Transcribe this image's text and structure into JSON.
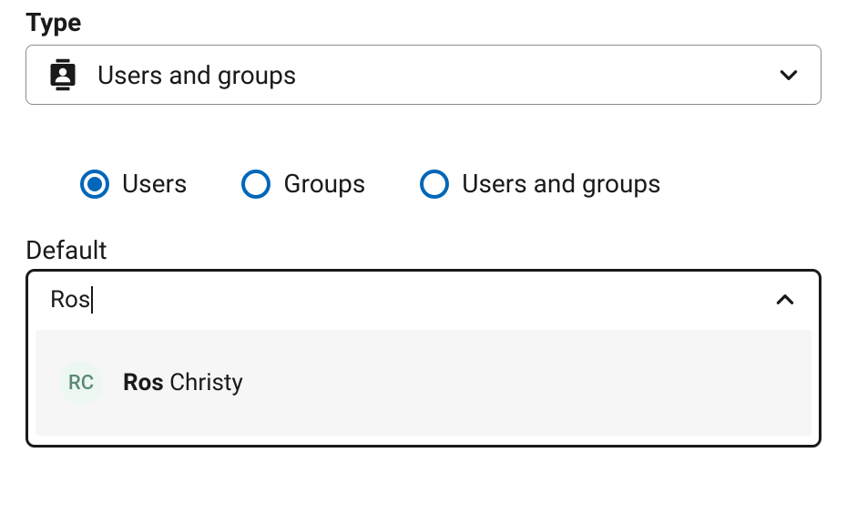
{
  "type": {
    "label": "Type",
    "selected": "Users and groups"
  },
  "radios": {
    "options": [
      {
        "label": "Users",
        "selected": true
      },
      {
        "label": "Groups",
        "selected": false
      },
      {
        "label": "Users and groups",
        "selected": false
      }
    ]
  },
  "default": {
    "label": "Default",
    "input_value": "Ros"
  },
  "dropdown": {
    "item": {
      "initials": "RC",
      "match": "Ros",
      "rest": " Christy"
    }
  }
}
